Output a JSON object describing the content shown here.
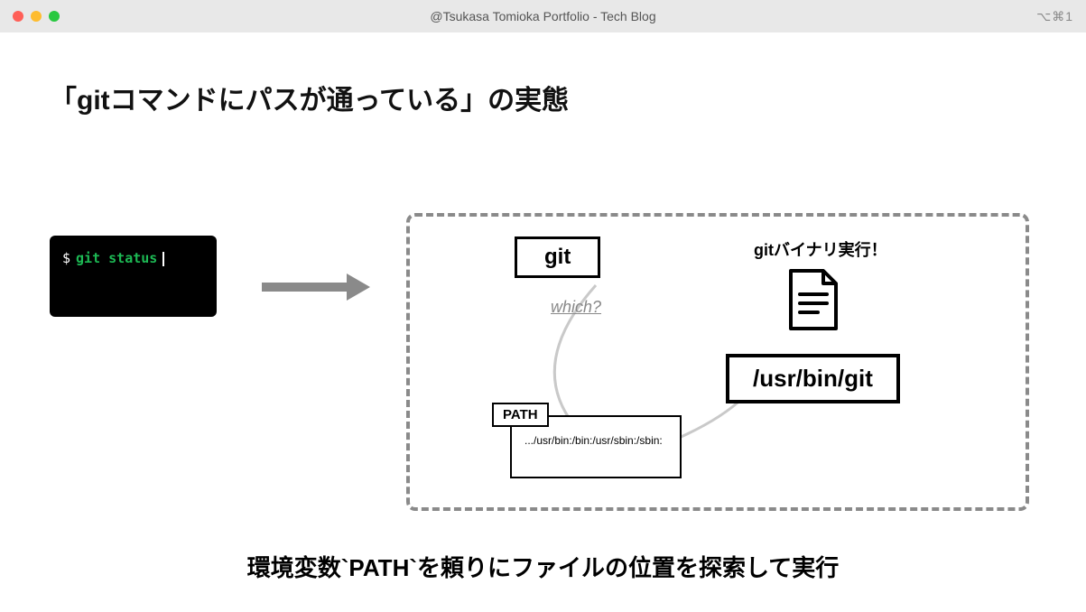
{
  "titlebar": {
    "title": "@Tsukasa Tomioka Portfolio - Tech Blog",
    "shortcut": "⌥⌘1"
  },
  "heading": "「gitコマンドにパスが通っている」の実態",
  "terminal": {
    "prompt": "$",
    "command": "git status"
  },
  "diagram": {
    "git_label": "git",
    "which_label": "which?",
    "path_label": "PATH",
    "path_value": ".../usr/bin:/bin:/usr/sbin:/sbin:",
    "binary_label": "gitバイナリ実行！",
    "resolved_path": "/usr/bin/git"
  },
  "footer": "環境変数`PATH`を頼りにファイルの位置を探索して実行"
}
